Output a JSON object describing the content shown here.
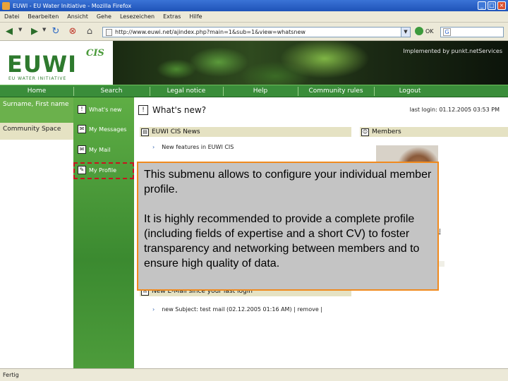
{
  "browser": {
    "window_title": "EUWI - EU Water Initiative - Mozilla Firefox",
    "window_buttons": {
      "minimize": "_",
      "maximize": "□",
      "close": "×"
    },
    "menu": [
      "Datei",
      "Bearbeiten",
      "Ansicht",
      "Gehe",
      "Lesezeichen",
      "Extras",
      "Hilfe"
    ],
    "url": "http://www.euwi.net/ajindex.php?main=1&sub=1&view=whatsnew",
    "go_label": "OK",
    "search_placeholder": "",
    "status": "Fertig",
    "icons": [
      "back-icon",
      "forward-icon",
      "reload-icon",
      "stop-icon",
      "home-icon"
    ]
  },
  "site": {
    "logo": {
      "name": "EUWI",
      "suffix": "CIS",
      "tagline": "EU WATER INITIATIVE"
    },
    "implemented_by": "Implemented by punkt.netServices",
    "nav": [
      "Home",
      "Search",
      "Legal notice",
      "Help",
      "Community rules",
      "Logout"
    ]
  },
  "user": {
    "name": "Surname, First name",
    "community_space": "Community Space"
  },
  "submenu": [
    {
      "label": "What's new",
      "icon": "!"
    },
    {
      "label": "My Messages",
      "icon": "✉"
    },
    {
      "label": "My Mail",
      "icon": "✉"
    },
    {
      "label": "My Profile",
      "icon": "✎"
    }
  ],
  "content": {
    "heading": "What's new?",
    "last_login": "last login: 01.12.2005 03:53 PM",
    "news_title": "EUWI CIS News",
    "news_item": "New features in EUWI CIS",
    "members_title": "Members",
    "member_link": "ll",
    "email_title": "New E-Mail since your last login",
    "email_item": "new Subject: test mail (02.12.2005 01:16 AM) | remove |"
  },
  "tooltip": {
    "line1": "This submenu allows to  configure your individual member profile.",
    "line2": "It is highly recommended to provide a complete profile (including fields of expertise and a short CV) to foster transparency and networking between members and to ensure high quality of data."
  },
  "colors": {
    "site_green": "#3a8d3a",
    "highlight_border": "#c8141e",
    "tooltip_border": "#f08a1e",
    "tooltip_bg": "#c4c4c4"
  }
}
